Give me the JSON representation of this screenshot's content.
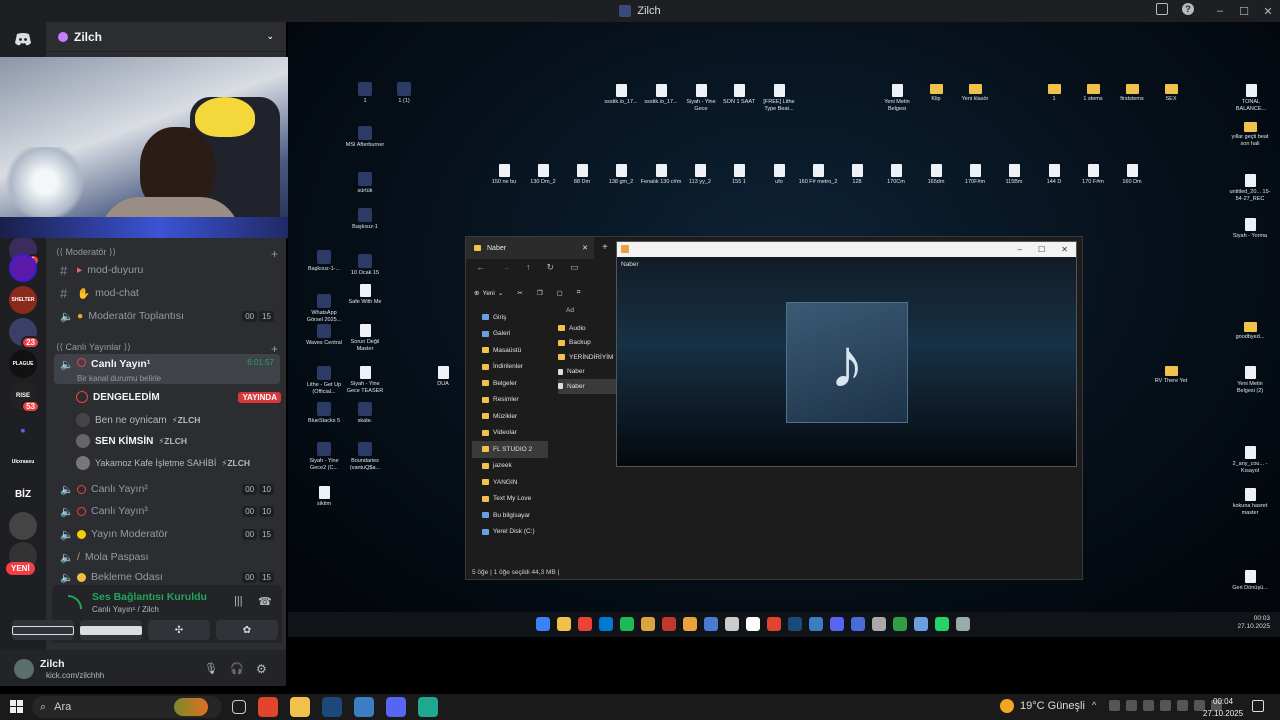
{
  "window": {
    "title": "Zilch"
  },
  "server": {
    "name": "Zilch"
  },
  "rail": {
    "badges": [
      "1",
      "23",
      "53"
    ],
    "labels": {
      "shelter": "SHELTER",
      "plague": "PLAGUE",
      "rise": "RISE",
      "biz": "BİZ",
      "ukrain": "Ukxraseu"
    },
    "new_label": "YENİ"
  },
  "channels": {
    "cat_moderator": "⟨⟨ Moderatör ⟩⟩",
    "mod_duyuru": "mod-duyuru",
    "mod_chat": "mod-chat",
    "moderator_toplantisi": "Moderatör Toplantısı",
    "cat_canli": "⟨⟨ Canlı Yayınlar ⟩⟩",
    "canli_yayin_1": "Canlı Yayın¹",
    "canli_yayin_1_time": "6:01:57",
    "canli_status": "Bir kanal durumu belirle",
    "canli_yayin_2": "Canlı Yayın²",
    "canli_yayin_3": "Canlı Yayın³",
    "yayin_moderator": "Yayın Moderatör",
    "mola_paspasi": "Mola Paspası",
    "bekleme_odasi": "Bekleme Odası",
    "count_00": "00",
    "count_15": "15",
    "count_10": "10"
  },
  "members": [
    {
      "name": "DENGELEDİM",
      "badge": "YAYINDA"
    },
    {
      "name": "Ben ne oynicam",
      "tag": "⚡ZLCH"
    },
    {
      "name": "SEN KİMSİN",
      "tag": "⚡ZLCH"
    },
    {
      "name": "Yakamoz Kafe İşletme SAHİBİ",
      "tag": "⚡ZLCH"
    }
  ],
  "voice": {
    "status": "Ses Bağlantısı Kuruldu",
    "sub": "Canlı Yayın¹ / Zilch"
  },
  "user": {
    "name": "Zilch",
    "sub": "kick.com/zilchhh"
  },
  "desktop": {
    "top_row": [
      "ssstik.io_17...",
      "ssstik.io_17...",
      "Siyah - Yine Gece",
      "SON 1 SAAT",
      "[FREE] Lithe Type Beat...",
      "Yeni Metin Belgesi",
      "Klip",
      "Yeni klasör",
      "1",
      "1 stems",
      "firststems",
      "SEX",
      "TONAL BALANCE..."
    ],
    "mid_row": [
      "150 ne bu",
      "130 Dm_2",
      "88 Dm",
      "138 gm_2",
      "Fenalık 130 c#m",
      "113 yy_2",
      "155 1",
      "ufo",
      "160 F# metro_2",
      "128",
      "170Cm",
      "165dm",
      "170F#m",
      "115Bm",
      "144 D",
      "170 F#m",
      "160 Dm"
    ],
    "left_col": [
      "1",
      "1 (1)",
      "MSI Afterburner",
      "sürtük",
      "Başkısız-1",
      "Başkısız-1-...",
      "10 Ocak 15",
      "WhatsApp Görsel 2025...",
      "Safe With Me",
      "Waves Central",
      "Sorun Değil Master",
      "DUA",
      "Lithe - Get Up (Official...",
      "Siyah - Yine Gece TEASER",
      "BlueStacks 5",
      "skate.",
      "Siyah - Yine Gece2 (C...",
      "Boundaries (vantuQ$a...",
      "siktim"
    ],
    "right_col": [
      "yıllar geçti beat son hali",
      "untitled_20... 15-54-27_REC",
      "Siyah - Yorma",
      "goodbyed...",
      "RV There Yet",
      "Yeni Metin Belgesi (2)",
      "2_any_cou... - Kısayol",
      "kokuna hasret master",
      "Geri Dönüşü..."
    ]
  },
  "explorer": {
    "tab_title": "Naber",
    "new_btn": "Yeni",
    "col_header": "Ad",
    "sidebar": [
      "Giriş",
      "Galeri",
      "Masaüstü",
      "İndirilenler",
      "Belgeler",
      "Resimler",
      "Müzikler",
      "Videolar",
      "FL STUDIO 2",
      "jazeek",
      "YANGIN",
      "Text My Love",
      "Bu bilgisayar",
      "Yerel Disk (C:)"
    ],
    "files": [
      "Audio",
      "Backup",
      "YERİNDİRİYİM",
      "Naber",
      "Naber"
    ],
    "status": "5 öğe  |  1 öğe seçildi 44,3 MB  |"
  },
  "player": {
    "title": "Naber",
    "note_icon": "music-note-icon"
  },
  "inner_taskbar": {
    "time": "00:03",
    "date": "27.10.2025"
  },
  "taskbar": {
    "search_placeholder": "Ara",
    "weather": "19°C  Güneşli",
    "time": "00:04",
    "date": "27.10.2025"
  },
  "colors": {
    "discord_bg": "#2b2d31",
    "discord_rail": "#1e1f22",
    "green": "#23a55a",
    "red": "#f23f43",
    "taskbar": "#1a1a1a"
  }
}
